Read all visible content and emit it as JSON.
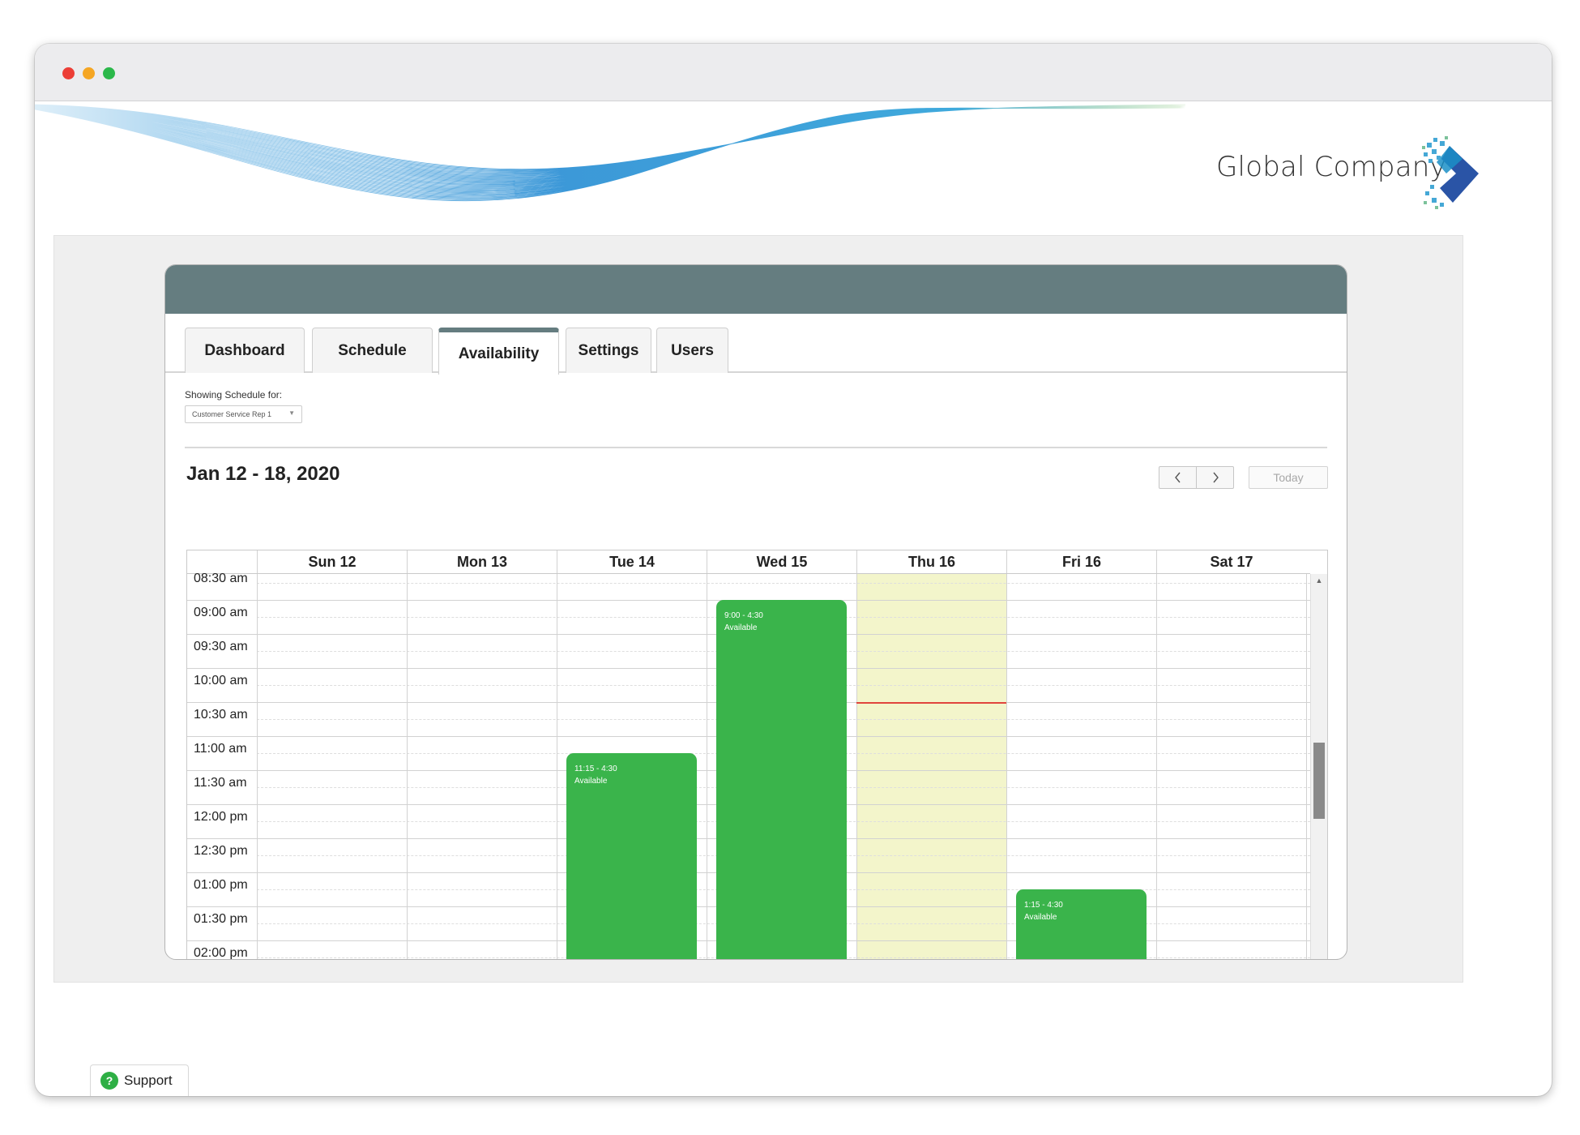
{
  "window": {
    "controls": [
      "close",
      "minimize",
      "maximize"
    ]
  },
  "brand": {
    "company_name": "Global Company",
    "logo_icon": "arrow-chevron-logo-icon"
  },
  "tabs": [
    {
      "label": "Dashboard",
      "active": false
    },
    {
      "label": "Schedule",
      "active": false
    },
    {
      "label": "Availability",
      "active": true
    },
    {
      "label": "Settings",
      "active": false
    },
    {
      "label": "Users",
      "active": false
    }
  ],
  "filter": {
    "label": "Showing Schedule for:",
    "selected": "Customer Service Rep 1"
  },
  "calendar": {
    "week_title": "Jan 12 - 18, 2020",
    "prev_icon": "chevron-left-icon",
    "next_icon": "chevron-right-icon",
    "today_label": "Today",
    "days": [
      "Sun 12",
      "Mon 13",
      "Tue 14",
      "Wed 15",
      "Thu 16",
      "Fri 16",
      "Sat 17"
    ],
    "today_index": 4,
    "times": [
      "08:30 am",
      "09:00 am",
      "09:30 am",
      "10:00 am",
      "10:30 am",
      "11:00 am",
      "11:30 am",
      "12:00 pm",
      "12:30 pm",
      "01:00 pm",
      "01:30 pm",
      "02:00 pm"
    ],
    "events": [
      {
        "day": "Tue 14",
        "time": "11:15 - 4:30",
        "status": "Available"
      },
      {
        "day": "Wed 15",
        "time": "9:00 - 4:30",
        "status": "Available"
      },
      {
        "day": "Fri 16",
        "time": "1:15 - 4:30",
        "status": "Available"
      }
    ]
  },
  "colors": {
    "header_bar": "#657d80",
    "available": "#3ab44b",
    "today_highlight": "#f3f5cb",
    "current_time": "#e0453d"
  },
  "support": {
    "label": "Support",
    "icon": "question-icon"
  }
}
